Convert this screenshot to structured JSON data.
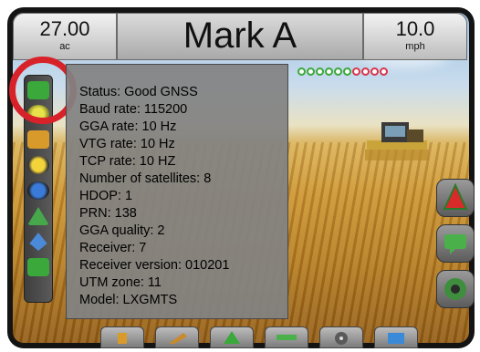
{
  "top_bar": {
    "left": {
      "value": "27.00",
      "unit": "ac"
    },
    "center": {
      "title": "Mark A"
    },
    "right": {
      "value": "10.0",
      "unit": "mph"
    }
  },
  "gnss_panel": {
    "lines": [
      "Status: Good GNSS",
      "Baud rate: 115200",
      "GGA rate: 10 Hz",
      "VTG rate: 10 Hz",
      "TCP rate: 10 HZ",
      "Number of satellites: 8",
      "HDOP: 1",
      "PRN: 138",
      "GGA quality: 2",
      "Receiver: 7",
      "Receiver version: 010201",
      "UTM zone: 11",
      "Model: LXGMTS"
    ]
  },
  "satellite_indicators": [
    "green",
    "green",
    "green",
    "green",
    "green",
    "green",
    "red",
    "red",
    "red",
    "red"
  ],
  "left_toolbar": {
    "icons": [
      "gnss-status-icon",
      "lightbar-icon",
      "section-icon",
      "boom-height-icon",
      "tilt-icon",
      "guidance-icon",
      "water-drop-icon",
      "battery-icon"
    ]
  },
  "right_buttons": [
    "navigation-arrow-icon",
    "chat-icon",
    "camera-icon"
  ],
  "bottom_buttons": [
    "console-icon",
    "implement-icon",
    "vehicle-view-icon",
    "bridge-icon",
    "disc-icon",
    "folder-icon"
  ],
  "colors": {
    "annotation_ring": "#d8222a",
    "good": "#3aa83a",
    "bad": "#d9344a"
  }
}
